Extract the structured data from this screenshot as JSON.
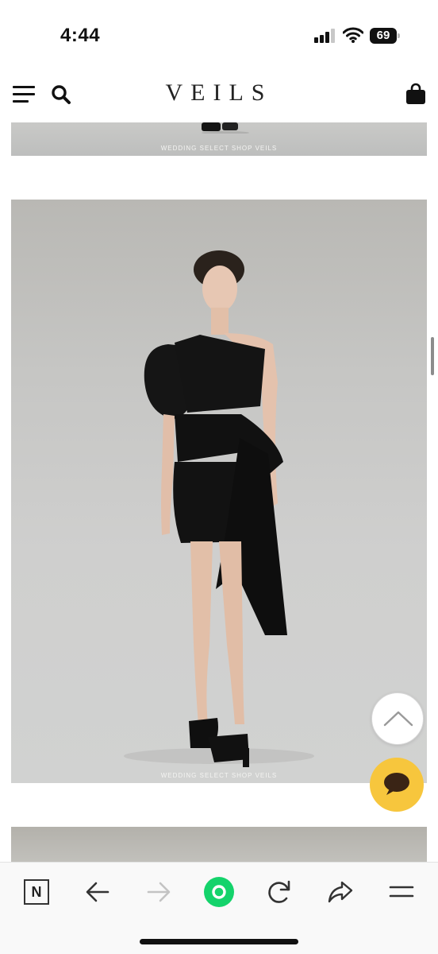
{
  "status_bar": {
    "time": "4:44",
    "battery_level": "69",
    "signal_bars_active": 3,
    "signal_bars_total": 4
  },
  "header": {
    "brand": "VEILS",
    "icons": [
      "menu-icon",
      "search-icon",
      "shopping-bag-icon"
    ]
  },
  "content": {
    "watermark_top": "WEDDING SELECT SHOP VEILS",
    "watermark_main": "WEDDING SELECT SHOP VEILS"
  },
  "floating": {
    "scroll_top_icon": "chevron-up-icon",
    "chat_icon": "chat-bubble-icon",
    "chat_color": "#f7c63d"
  },
  "browser_toolbar": {
    "n_logo": "N",
    "icons": [
      "n-logo-icon",
      "back-arrow-icon",
      "forward-arrow-icon",
      "home-circle-icon",
      "reload-icon",
      "share-icon",
      "menu-icon"
    ],
    "accent_color": "#14d36b"
  }
}
